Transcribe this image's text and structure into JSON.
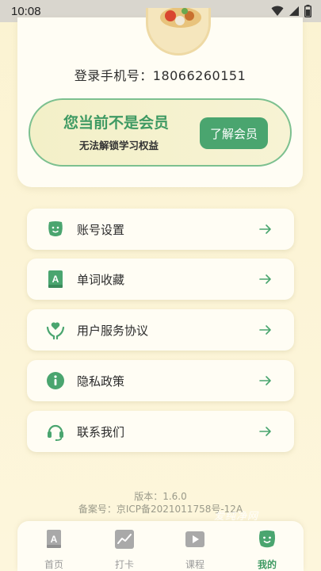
{
  "status_bar": {
    "time": "10:08"
  },
  "profile": {
    "phone_label": "登录手机号：",
    "phone_number": "18066260151"
  },
  "membership": {
    "title": "您当前不是会员",
    "subtitle": "无法解锁学习权益",
    "button_label": "了解会员"
  },
  "menu": [
    {
      "label": "账号设置",
      "icon": "face-icon"
    },
    {
      "label": "单词收藏",
      "icon": "book-icon"
    },
    {
      "label": "用户服务协议",
      "icon": "heart-hands-icon"
    },
    {
      "label": "隐私政策",
      "icon": "info-icon"
    },
    {
      "label": "联系我们",
      "icon": "headset-icon"
    }
  ],
  "footer": {
    "version": "版本：1.6.0",
    "icp": "备案号：京ICP备2021011758号-12A",
    "watermark": "爱纯净网"
  },
  "tabs": [
    {
      "label": "首页",
      "icon": "home-book-icon",
      "active": false
    },
    {
      "label": "打卡",
      "icon": "trend-chart-icon",
      "active": false
    },
    {
      "label": "课程",
      "icon": "video-play-icon",
      "active": false
    },
    {
      "label": "我的",
      "icon": "face-icon",
      "active": true
    }
  ],
  "colors": {
    "accent": "#4aa56f",
    "accent_dark": "#3f9a63",
    "background": "#fcf4d6",
    "card": "#fffdf4"
  }
}
